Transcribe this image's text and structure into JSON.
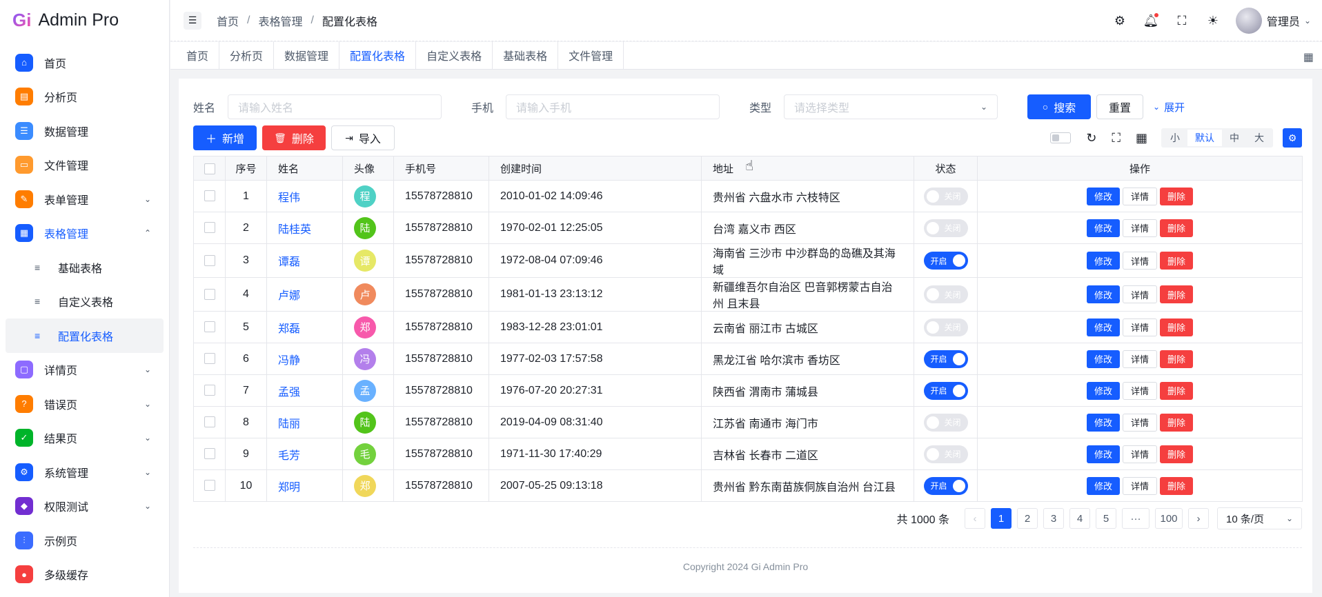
{
  "app": {
    "logo_mark": "Gi",
    "title": "Admin Pro"
  },
  "sidebar": {
    "items": [
      {
        "label": "首页",
        "icon": "home-icon",
        "color": "#165dff",
        "glyph": "⌂"
      },
      {
        "label": "分析页",
        "icon": "analysis-icon",
        "color": "#ff7d00",
        "glyph": "▤"
      },
      {
        "label": "数据管理",
        "icon": "data-icon",
        "color": "#3b8cff",
        "glyph": "☰"
      },
      {
        "label": "文件管理",
        "icon": "folder-icon",
        "color": "#ff9a2e",
        "glyph": "▭"
      },
      {
        "label": "表单管理",
        "icon": "form-icon",
        "color": "#ff7d00",
        "glyph": "✎",
        "arrow": "⌄"
      },
      {
        "label": "表格管理",
        "icon": "table-icon",
        "color": "#165dff",
        "glyph": "▦",
        "arrow": "⌃"
      }
    ],
    "sub_items": [
      {
        "label": "基础表格"
      },
      {
        "label": "自定义表格"
      },
      {
        "label": "配置化表格"
      }
    ],
    "items_after": [
      {
        "label": "详情页",
        "icon": "detail-icon",
        "color": "#8d6bff",
        "glyph": "▢",
        "arrow": "⌄"
      },
      {
        "label": "错误页",
        "icon": "error-icon",
        "color": "#ff7d00",
        "glyph": "?",
        "arrow": "⌄"
      },
      {
        "label": "结果页",
        "icon": "result-icon",
        "color": "#00b42a",
        "glyph": "✓",
        "arrow": "⌄"
      },
      {
        "label": "系统管理",
        "icon": "system-icon",
        "color": "#165dff",
        "glyph": "⚙",
        "arrow": "⌄"
      },
      {
        "label": "权限测试",
        "icon": "shield-icon",
        "color": "#722ed1",
        "glyph": "◆",
        "arrow": "⌄"
      },
      {
        "label": "示例页",
        "icon": "example-icon",
        "color": "#3b6cff",
        "glyph": "⫶"
      },
      {
        "label": "多级缓存",
        "icon": "cache-icon",
        "color": "#f53f3f",
        "glyph": "●"
      }
    ]
  },
  "header": {
    "breadcrumb": [
      "首页",
      "表格管理",
      "配置化表格"
    ],
    "user_name": "管理员"
  },
  "tabs": [
    "首页",
    "分析页",
    "数据管理",
    "配置化表格",
    "自定义表格",
    "基础表格",
    "文件管理"
  ],
  "search": {
    "name_label": "姓名",
    "name_placeholder": "请输入姓名",
    "phone_label": "手机",
    "phone_placeholder": "请输入手机",
    "type_label": "类型",
    "type_placeholder": "请选择类型",
    "search_btn": "搜索",
    "reset_btn": "重置",
    "expand_btn": "展开"
  },
  "toolbar": {
    "add_btn": "新增",
    "delete_btn": "删除",
    "import_btn": "导入",
    "sizes": [
      "小",
      "默认",
      "中",
      "大"
    ]
  },
  "table": {
    "headers": [
      "序号",
      "姓名",
      "头像",
      "手机号",
      "创建时间",
      "地址",
      "状态",
      "操作"
    ],
    "rows": [
      {
        "no": "1",
        "name": "程伟",
        "avatar": "程",
        "avatar_color": "#4fd1c5",
        "phone": "15578728810",
        "created": "2010-01-02 14:09:46",
        "address": "贵州省 六盘水市 六枝特区",
        "status": "关闭",
        "on": false
      },
      {
        "no": "2",
        "name": "陆桂英",
        "avatar": "陆",
        "avatar_color": "#52c41a",
        "phone": "15578728810",
        "created": "1970-02-01 12:25:05",
        "address": "台湾 嘉义市 西区",
        "status": "关闭",
        "on": false
      },
      {
        "no": "3",
        "name": "谭磊",
        "avatar": "谭",
        "avatar_color": "#e6e866",
        "phone": "15578728810",
        "created": "1972-08-04 07:09:46",
        "address": "海南省 三沙市 中沙群岛的岛礁及其海域",
        "status": "开启",
        "on": true
      },
      {
        "no": "4",
        "name": "卢娜",
        "avatar": "卢",
        "avatar_color": "#f08a5d",
        "phone": "15578728810",
        "created": "1981-01-13 23:13:12",
        "address": "新疆维吾尔自治区 巴音郭楞蒙古自治州 且末县",
        "status": "关闭",
        "on": false
      },
      {
        "no": "5",
        "name": "郑磊",
        "avatar": "郑",
        "avatar_color": "#f759ab",
        "phone": "15578728810",
        "created": "1983-12-28 23:01:01",
        "address": "云南省 丽江市 古城区",
        "status": "关闭",
        "on": false
      },
      {
        "no": "6",
        "name": "冯静",
        "avatar": "冯",
        "avatar_color": "#b37feb",
        "phone": "15578728810",
        "created": "1977-02-03 17:57:58",
        "address": "黑龙江省 哈尔滨市 香坊区",
        "status": "开启",
        "on": true
      },
      {
        "no": "7",
        "name": "孟强",
        "avatar": "孟",
        "avatar_color": "#69b1ff",
        "phone": "15578728810",
        "created": "1976-07-20 20:27:31",
        "address": "陕西省 渭南市 蒲城县",
        "status": "开启",
        "on": true
      },
      {
        "no": "8",
        "name": "陆丽",
        "avatar": "陆",
        "avatar_color": "#52c41a",
        "phone": "15578728810",
        "created": "2019-04-09 08:31:40",
        "address": "江苏省 南通市 海门市",
        "status": "关闭",
        "on": false
      },
      {
        "no": "9",
        "name": "毛芳",
        "avatar": "毛",
        "avatar_color": "#73d13d",
        "phone": "15578728810",
        "created": "1971-11-30 17:40:29",
        "address": "吉林省 长春市 二道区",
        "status": "关闭",
        "on": false
      },
      {
        "no": "10",
        "name": "郑明",
        "avatar": "郑",
        "avatar_color": "#f0d75a",
        "phone": "15578728810",
        "created": "2007-05-25 09:13:18",
        "address": "贵州省 黔东南苗族侗族自治州 台江县",
        "status": "开启",
        "on": true
      }
    ],
    "actions": {
      "edit": "修改",
      "detail": "详情",
      "delete": "删除"
    }
  },
  "pagination": {
    "total": "共 1000 条",
    "pages": [
      "1",
      "2",
      "3",
      "4",
      "5",
      "···",
      "100"
    ],
    "current": "1",
    "page_size": "10 条/页"
  },
  "footer": {
    "copyright": "Copyright 2024 Gi Admin Pro"
  },
  "colors": {
    "primary": "#165dff",
    "danger": "#f53f3f"
  }
}
